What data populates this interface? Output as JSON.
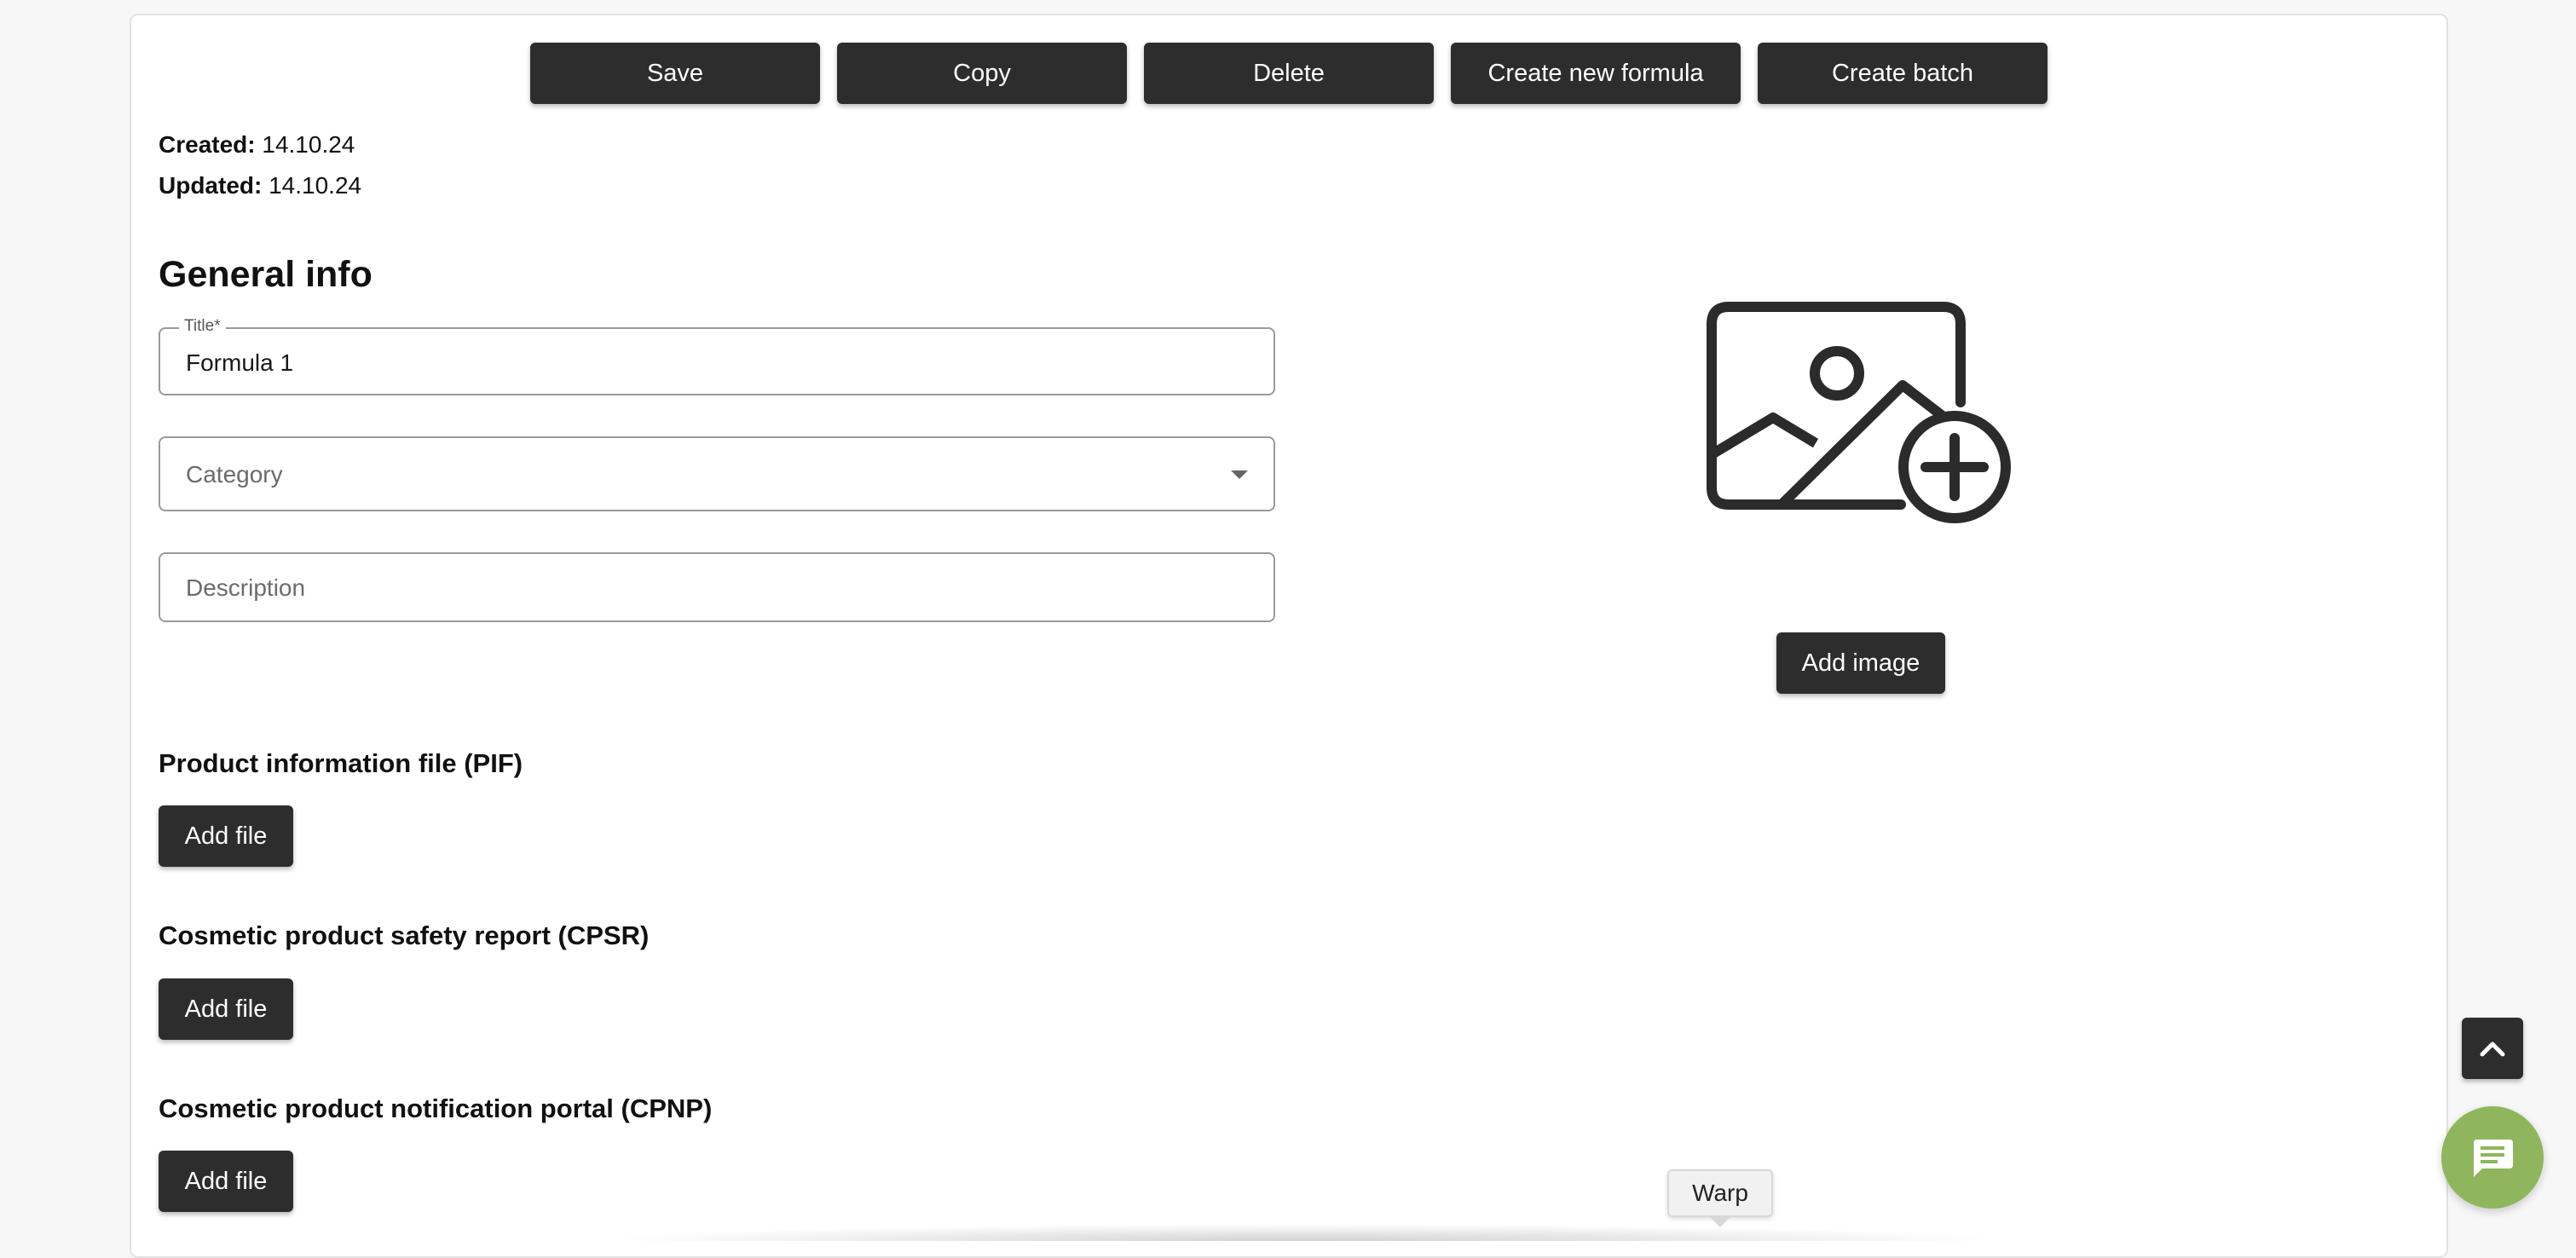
{
  "toolbar": {
    "save_label": "Save",
    "copy_label": "Copy",
    "delete_label": "Delete",
    "create_formula_label": "Create new formula",
    "create_batch_label": "Create batch"
  },
  "meta": {
    "created_label": "Created:",
    "created_value": "14.10.24",
    "updated_label": "Updated:",
    "updated_value": "14.10.24"
  },
  "general_info": {
    "heading": "General info",
    "title_field": {
      "label": "Title*",
      "value": "Formula 1"
    },
    "category_field": {
      "placeholder": "Category"
    },
    "description_field": {
      "placeholder": "Description"
    }
  },
  "image": {
    "icon": "add-photo-icon",
    "add_label": "Add image"
  },
  "files": [
    {
      "label": "Product information file (PIF)",
      "button": "Add file"
    },
    {
      "label": "Cosmetic product safety report (CPSR)",
      "button": "Add file"
    },
    {
      "label": "Cosmetic product notification portal (CPNP)",
      "button": "Add file"
    }
  ],
  "floating": {
    "scroll_top_icon": "chevron-up-icon",
    "chat_icon": "chat-icon",
    "tooltip_text": "Warp"
  },
  "colors": {
    "button_bg": "#2d2d2d",
    "button_text": "#ffffff",
    "chat_bubble": "#8fb65c",
    "page_bg": "#f7f7f7"
  }
}
